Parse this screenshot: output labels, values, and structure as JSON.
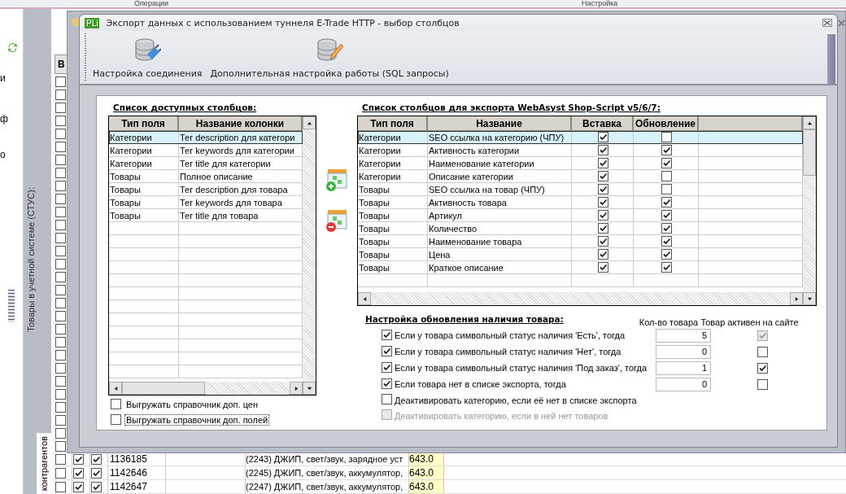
{
  "top_ribbon": {
    "groups": [
      "Операции",
      "Настройка"
    ]
  },
  "left_panel": {
    "fragments": [
      "и",
      "ф",
      "о"
    ]
  },
  "side_tabs": [
    {
      "label": "Товары в учетной системе (СТУС):",
      "selected": false
    },
    {
      "label": "контрагентов",
      "selected": true
    }
  ],
  "background_table": {
    "header": "В",
    "covered_rows": [
      {
        "checked": false
      },
      {
        "checked": false
      },
      {
        "checked": false
      },
      {
        "checked": false
      },
      {
        "checked": false
      },
      {
        "checked": false
      },
      {
        "checked": false
      },
      {
        "checked": false
      },
      {
        "checked": false
      },
      {
        "checked": false
      },
      {
        "checked": false
      },
      {
        "checked": false
      },
      {
        "checked": false
      },
      {
        "checked": false
      },
      {
        "checked": false
      },
      {
        "checked": false
      },
      {
        "checked": false
      },
      {
        "checked": false
      },
      {
        "checked": false
      },
      {
        "checked": false
      },
      {
        "checked": false
      },
      {
        "checked": false
      },
      {
        "checked": false
      },
      {
        "checked": false
      },
      {
        "checked": false
      },
      {
        "checked": false
      },
      {
        "checked": false
      },
      {
        "checked": false
      },
      {
        "checked": false
      }
    ],
    "rows": [
      {
        "checks": [
          false,
          true,
          true
        ],
        "id": "1136185",
        "description": "(2243) ДЖИП, свет/звук, зарядное уст",
        "price": "643.0"
      },
      {
        "checks": [
          false,
          true,
          true
        ],
        "id": "1142646",
        "description": "(2245) ДЖИП, свет/звук, аккумулятор,",
        "price": "643.0"
      },
      {
        "checks": [
          false,
          true,
          true
        ],
        "id": "1142647",
        "description": "(2247) ДЖИП, свет/звук, аккумулятор,",
        "price": "643.0"
      }
    ]
  },
  "dialog": {
    "badge": "PLi",
    "title": "Экспорт данных с использованием туннеля E-Trade HTTP - выбор столбцов",
    "toolbar": [
      {
        "kind": "connection",
        "label": "Настройка соединения"
      },
      {
        "kind": "sql",
        "label": "Дополнительная настройка работы (SQL запросы)"
      }
    ],
    "available": {
      "title": "Список доступных столбцов:",
      "columns": [
        "Тип поля",
        "Название колонки"
      ],
      "rows": [
        {
          "type": "Категории",
          "name": "Тег description для категори",
          "selected": true
        },
        {
          "type": "Категории",
          "name": "Тег keywords для категории",
          "selected": false
        },
        {
          "type": "Категории",
          "name": "Тег title для категории",
          "selected": false
        },
        {
          "type": "Товары",
          "name": "Полное описание",
          "selected": false
        },
        {
          "type": "Товары",
          "name": "Тег description для товара",
          "selected": false
        },
        {
          "type": "Товары",
          "name": "Тег keywords для товара",
          "selected": false
        },
        {
          "type": "Товары",
          "name": "Тег title для товара",
          "selected": false
        }
      ],
      "options": [
        {
          "label": "Выгружать справочник доп. цен",
          "checked": false,
          "focused": false
        },
        {
          "label": "Выгружать справочник доп. полей",
          "checked": false,
          "focused": true
        }
      ]
    },
    "transfer_buttons": [
      {
        "kind": "add"
      },
      {
        "kind": "remove"
      }
    ],
    "export": {
      "title": "Список столбцов для экспорта WebAsyst Shop-Script v5/6/7:",
      "columns": [
        "Тип поля",
        "Название",
        "Вставка",
        "Обновление"
      ],
      "rows": [
        {
          "type": "Категории",
          "name": "SEO ссылка на категорию (ЧПУ)",
          "insert": true,
          "update": false,
          "selected": true
        },
        {
          "type": "Категории",
          "name": "Активность категории",
          "insert": true,
          "update": true,
          "selected": false
        },
        {
          "type": "Категории",
          "name": "Наименование категории",
          "insert": true,
          "update": true,
          "selected": false
        },
        {
          "type": "Категории",
          "name": "Описание категории",
          "insert": true,
          "update": false,
          "selected": false
        },
        {
          "type": "Товары",
          "name": "SEO ссылка на товар (ЧПУ)",
          "insert": true,
          "update": false,
          "selected": false
        },
        {
          "type": "Товары",
          "name": "Активность товара",
          "insert": true,
          "update": true,
          "selected": false
        },
        {
          "type": "Товары",
          "name": "Артикул",
          "insert": true,
          "update": true,
          "selected": false
        },
        {
          "type": "Товары",
          "name": "Количество",
          "insert": true,
          "update": true,
          "selected": false
        },
        {
          "type": "Товары",
          "name": "Наименование товара",
          "insert": true,
          "update": true,
          "selected": false
        },
        {
          "type": "Товары",
          "name": "Цена",
          "insert": true,
          "update": true,
          "selected": false
        },
        {
          "type": "Товары",
          "name": "Краткое описание",
          "insert": true,
          "update": true,
          "selected": false
        }
      ]
    },
    "stock": {
      "title": "Настройка обновления наличия товара:",
      "qty_header": "Кол-во товара",
      "active_header": "Товар активен на сайте",
      "rows": [
        {
          "kind": "rule",
          "label": "Если у товара символьный статус наличия 'Есть', тогда",
          "checked": true,
          "quantity": "5",
          "active": true,
          "active_disabled": true
        },
        {
          "kind": "rule",
          "label": "Если у товара символьный статус наличия 'Нет', тогда",
          "checked": true,
          "quantity": "0",
          "active": false,
          "active_disabled": false
        },
        {
          "kind": "rule",
          "label": "Если у товара символьный статус наличия 'Под заказ', тогда",
          "checked": true,
          "quantity": "1",
          "active": true,
          "active_disabled": false
        },
        {
          "kind": "rule",
          "label": "Если товара нет в списке экспорта, тогда",
          "checked": true,
          "quantity": "0",
          "active": false,
          "active_disabled": false
        },
        {
          "kind": "option",
          "label": "Деактивировать категорию, если её нет в списке экспорта",
          "checked": false,
          "disabled": false
        },
        {
          "kind": "option",
          "label": "Деактивировать категорию, если в ней нет товаров",
          "checked": false,
          "disabled": true
        }
      ]
    }
  }
}
